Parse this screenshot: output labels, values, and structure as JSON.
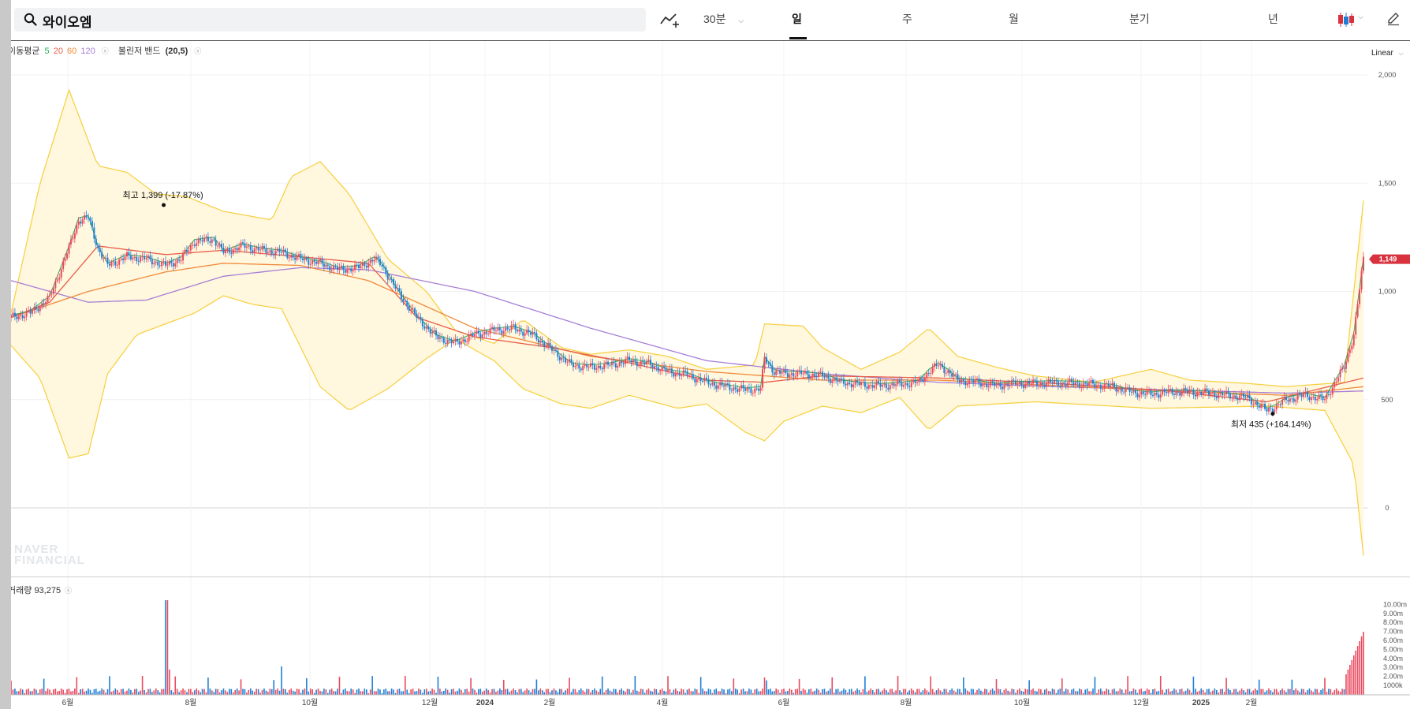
{
  "search": {
    "stock_name": "와이오엠"
  },
  "toolbar": {
    "intraday_label": "30분",
    "tabs": [
      "일",
      "주",
      "월",
      "분기",
      "년"
    ],
    "active_tab": "일"
  },
  "legend": {
    "ma_label": "이동평균",
    "ma_periods": [
      "5",
      "20",
      "60",
      "120"
    ],
    "bb_label": "볼린저 밴드",
    "bb_params": "(20,5)"
  },
  "scale_button": "Linear",
  "volume_legend": {
    "label": "거래량",
    "value": "93,275"
  },
  "watermark": [
    "NAVER",
    "FINANCIAL"
  ],
  "colors": {
    "ma5": "#2bb35a",
    "ma20": "#e85d4a",
    "ma60": "#f08a3c",
    "ma120": "#a77ed6",
    "bollinger": "#f6cf3c",
    "up": "#e84a5f",
    "down": "#1f7fd6",
    "price_tag": "#d8323f"
  },
  "chart_data": {
    "type": "candlestick",
    "price_axis": {
      "ticks": [
        0,
        500,
        1000,
        1500,
        2000
      ],
      "tick_labels": [
        "0",
        "500",
        "1,000",
        "1,500",
        "2,000"
      ],
      "ylim": [
        -220,
        2050
      ]
    },
    "volume_axis": {
      "tick_labels": [
        "1000k",
        "2.00m",
        "3.00m",
        "4.00m",
        "5.00m",
        "6.00m",
        "7.00m",
        "8.00m",
        "9.00m",
        "10.00m"
      ]
    },
    "x_axis": {
      "labels": [
        "6월",
        "8월",
        "10월",
        "12월",
        "2024",
        "2월",
        "4월",
        "6월",
        "8월",
        "10월",
        "12월",
        "2025",
        "2월"
      ],
      "bold": [
        false,
        false,
        false,
        false,
        true,
        false,
        false,
        false,
        false,
        false,
        false,
        true,
        false
      ]
    },
    "current_price": "1,149",
    "annotations": [
      {
        "label": "최고",
        "value": "1,399",
        "change": "(-17.87%)",
        "price": 1399
      },
      {
        "label": "최저",
        "value": "435",
        "change": "(+164.14%)",
        "price": 435
      }
    ],
    "close_series": [
      [
        0,
        880
      ],
      [
        10,
        900
      ],
      [
        20,
        970
      ],
      [
        30,
        1200
      ],
      [
        35,
        1330
      ],
      [
        40,
        1340
      ],
      [
        45,
        1200
      ],
      [
        50,
        1120
      ],
      [
        60,
        1160
      ],
      [
        70,
        1150
      ],
      [
        80,
        1120
      ],
      [
        88,
        1150
      ],
      [
        95,
        1230
      ],
      [
        105,
        1240
      ],
      [
        110,
        1180
      ],
      [
        120,
        1210
      ],
      [
        130,
        1190
      ],
      [
        140,
        1180
      ],
      [
        150,
        1150
      ],
      [
        160,
        1130
      ],
      [
        170,
        1100
      ],
      [
        180,
        1110
      ],
      [
        188,
        1150
      ],
      [
        192,
        1120
      ],
      [
        200,
        1000
      ],
      [
        210,
        880
      ],
      [
        220,
        790
      ],
      [
        230,
        760
      ],
      [
        240,
        800
      ],
      [
        250,
        820
      ],
      [
        260,
        830
      ],
      [
        270,
        800
      ],
      [
        280,
        730
      ],
      [
        290,
        660
      ],
      [
        300,
        650
      ],
      [
        310,
        660
      ],
      [
        320,
        680
      ],
      [
        330,
        665
      ],
      [
        340,
        630
      ],
      [
        350,
        615
      ],
      [
        360,
        580
      ],
      [
        370,
        560
      ],
      [
        380,
        545
      ],
      [
        388,
        550
      ],
      [
        390,
        690
      ],
      [
        395,
        630
      ],
      [
        400,
        620
      ],
      [
        410,
        620
      ],
      [
        420,
        610
      ],
      [
        430,
        580
      ],
      [
        440,
        570
      ],
      [
        450,
        565
      ],
      [
        460,
        570
      ],
      [
        470,
        580
      ],
      [
        475,
        630
      ],
      [
        480,
        660
      ],
      [
        485,
        630
      ],
      [
        490,
        590
      ],
      [
        500,
        580
      ],
      [
        510,
        565
      ],
      [
        520,
        575
      ],
      [
        530,
        575
      ],
      [
        540,
        578
      ],
      [
        550,
        575
      ],
      [
        560,
        570
      ],
      [
        570,
        560
      ],
      [
        580,
        535
      ],
      [
        590,
        525
      ],
      [
        600,
        535
      ],
      [
        610,
        535
      ],
      [
        620,
        530
      ],
      [
        630,
        520
      ],
      [
        640,
        508
      ],
      [
        650,
        450
      ],
      [
        655,
        470
      ],
      [
        660,
        500
      ],
      [
        670,
        520
      ],
      [
        680,
        500
      ],
      [
        690,
        650
      ],
      [
        695,
        800
      ],
      [
        700,
        1149
      ]
    ],
    "ma120_series": [
      [
        0,
        1050
      ],
      [
        40,
        950
      ],
      [
        70,
        960
      ],
      [
        110,
        1070
      ],
      [
        150,
        1110
      ],
      [
        185,
        1100
      ],
      [
        240,
        1000
      ],
      [
        300,
        830
      ],
      [
        360,
        680
      ],
      [
        420,
        620
      ],
      [
        480,
        580
      ],
      [
        540,
        560
      ],
      [
        600,
        545
      ],
      [
        660,
        530
      ],
      [
        700,
        540
      ]
    ],
    "ma60_series": [
      [
        0,
        880
      ],
      [
        40,
        1000
      ],
      [
        80,
        1090
      ],
      [
        110,
        1130
      ],
      [
        150,
        1120
      ],
      [
        185,
        1050
      ],
      [
        240,
        830
      ],
      [
        300,
        700
      ],
      [
        360,
        630
      ],
      [
        420,
        590
      ],
      [
        480,
        590
      ],
      [
        540,
        565
      ],
      [
        600,
        540
      ],
      [
        660,
        520
      ],
      [
        700,
        560
      ]
    ],
    "ma20_series": [
      [
        0,
        880
      ],
      [
        20,
        950
      ],
      [
        45,
        1210
      ],
      [
        80,
        1170
      ],
      [
        110,
        1190
      ],
      [
        150,
        1160
      ],
      [
        185,
        1130
      ],
      [
        210,
        880
      ],
      [
        240,
        790
      ],
      [
        280,
        740
      ],
      [
        320,
        670
      ],
      [
        360,
        590
      ],
      [
        390,
        580
      ],
      [
        420,
        610
      ],
      [
        480,
        600
      ],
      [
        540,
        575
      ],
      [
        600,
        540
      ],
      [
        650,
        490
      ],
      [
        700,
        600
      ]
    ],
    "bb_upper": [
      [
        0,
        900
      ],
      [
        15,
        1500
      ],
      [
        30,
        1930
      ],
      [
        45,
        1580
      ],
      [
        60,
        1550
      ],
      [
        75,
        1450
      ],
      [
        90,
        1440
      ],
      [
        110,
        1370
      ],
      [
        135,
        1330
      ],
      [
        145,
        1530
      ],
      [
        160,
        1600
      ],
      [
        175,
        1450
      ],
      [
        195,
        1150
      ],
      [
        215,
        1000
      ],
      [
        230,
        820
      ],
      [
        250,
        760
      ],
      [
        265,
        870
      ],
      [
        285,
        740
      ],
      [
        300,
        710
      ],
      [
        320,
        730
      ],
      [
        340,
        700
      ],
      [
        360,
        640
      ],
      [
        385,
        660
      ],
      [
        390,
        850
      ],
      [
        410,
        840
      ],
      [
        420,
        740
      ],
      [
        440,
        640
      ],
      [
        460,
        720
      ],
      [
        475,
        830
      ],
      [
        490,
        700
      ],
      [
        510,
        650
      ],
      [
        530,
        610
      ],
      [
        560,
        580
      ],
      [
        590,
        640
      ],
      [
        610,
        590
      ],
      [
        640,
        575
      ],
      [
        660,
        560
      ],
      [
        690,
        580
      ],
      [
        700,
        1420
      ]
    ],
    "bb_lower": [
      [
        0,
        750
      ],
      [
        15,
        600
      ],
      [
        30,
        230
      ],
      [
        40,
        250
      ],
      [
        50,
        620
      ],
      [
        65,
        800
      ],
      [
        80,
        850
      ],
      [
        95,
        900
      ],
      [
        110,
        980
      ],
      [
        125,
        940
      ],
      [
        140,
        920
      ],
      [
        160,
        560
      ],
      [
        175,
        450
      ],
      [
        195,
        550
      ],
      [
        215,
        690
      ],
      [
        230,
        780
      ],
      [
        250,
        680
      ],
      [
        265,
        550
      ],
      [
        285,
        480
      ],
      [
        300,
        460
      ],
      [
        320,
        520
      ],
      [
        345,
        460
      ],
      [
        360,
        480
      ],
      [
        380,
        350
      ],
      [
        390,
        310
      ],
      [
        400,
        400
      ],
      [
        420,
        470
      ],
      [
        440,
        440
      ],
      [
        460,
        510
      ],
      [
        475,
        360
      ],
      [
        490,
        470
      ],
      [
        510,
        480
      ],
      [
        530,
        490
      ],
      [
        560,
        475
      ],
      [
        590,
        460
      ],
      [
        620,
        465
      ],
      [
        650,
        470
      ],
      [
        680,
        450
      ],
      [
        695,
        200
      ],
      [
        700,
        -220
      ]
    ]
  }
}
